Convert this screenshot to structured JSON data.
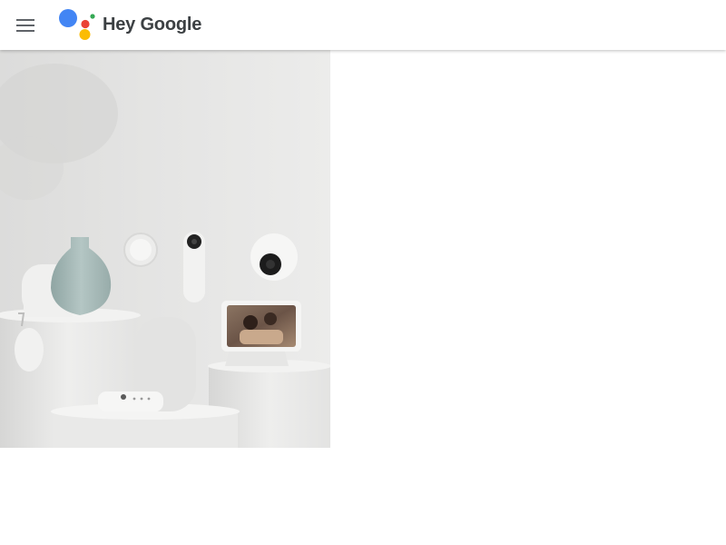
{
  "header": {
    "menu_icon": "hamburger-menu-icon",
    "brand": {
      "text": "Hey Google",
      "logo_icon": "google-assistant-dots-logo",
      "colors": {
        "blue": "#4285f4",
        "red": "#ea4335",
        "yellow": "#fbbc04",
        "green": "#34a853"
      }
    }
  },
  "hero": {
    "image": "google-nest-devices-product-lineup",
    "products": [
      "nest-wifi-router",
      "nest-wifi-point",
      "chromecast-remote",
      "nest-audio-speaker",
      "nest-thermostat",
      "nest-doorbell",
      "nest-cam",
      "nest-hub-max-display",
      "ceramic-vase"
    ]
  }
}
